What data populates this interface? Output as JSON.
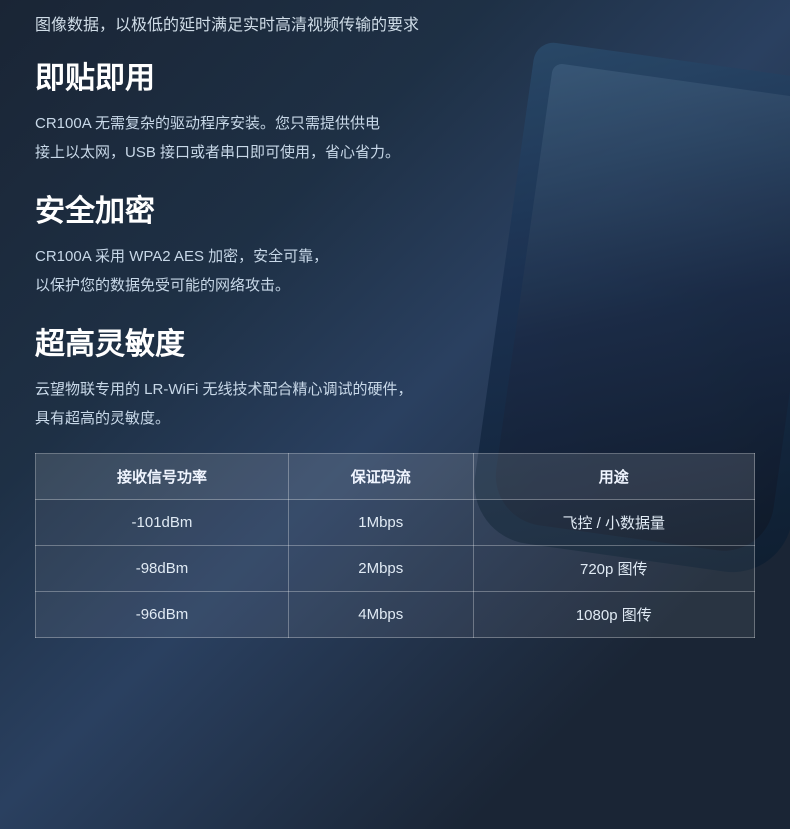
{
  "intro": {
    "text": "图像数据，以极低的延时满足实时高清视频传输的要求"
  },
  "sections": [
    {
      "id": "plug-and-play",
      "title": "即贴即用",
      "body_lines": [
        "CR100A 无需复杂的驱动程序安装。您只需提供供电",
        "接上以太网，USB 接口或者串口即可使用，省心省力。"
      ]
    },
    {
      "id": "security",
      "title": "安全加密",
      "body_lines": [
        "CR100A 采用 WPA2 AES 加密，安全可靠，",
        "以保护您的数据免受可能的网络攻击。"
      ]
    },
    {
      "id": "sensitivity",
      "title": "超高灵敏度",
      "body_lines": [
        "云望物联专用的 LR-WiFi 无线技术配合精心调试的硬件，",
        "具有超高的灵敏度。"
      ]
    }
  ],
  "table": {
    "headers": [
      "接收信号功率",
      "保证码流",
      "用途"
    ],
    "rows": [
      [
        "-101dBm",
        "1Mbps",
        "飞控 / 小数据量"
      ],
      [
        "-98dBm",
        "2Mbps",
        "720p 图传"
      ],
      [
        "-96dBm",
        "4Mbps",
        "1080p 图传"
      ]
    ]
  }
}
